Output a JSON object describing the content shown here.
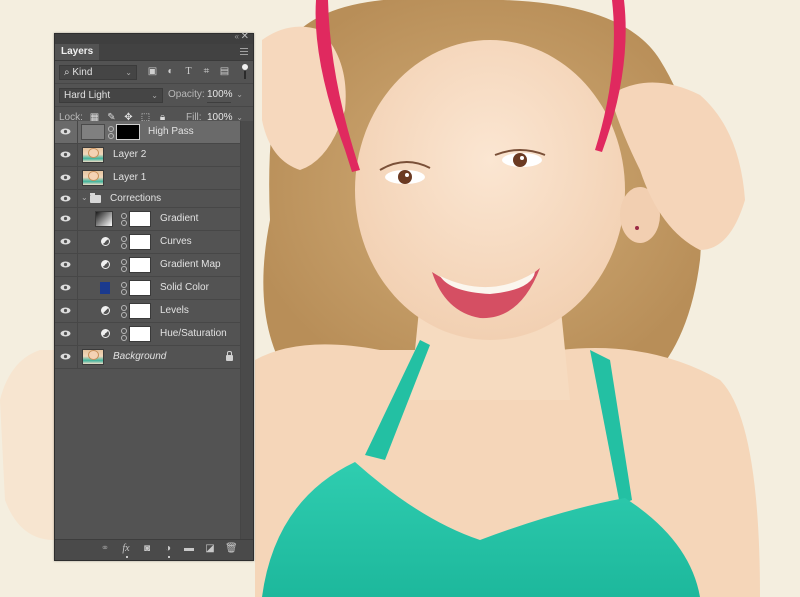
{
  "canvas": {
    "description": "Smiling young girl with curly blonde hair, pink headband and teal halter top",
    "colors": {
      "background": "#f4eedf",
      "skin": "#f6dcc3",
      "hair": "#c8a06a",
      "headband": "#e0295f",
      "top": "#26c2a6"
    }
  },
  "panel": {
    "tab_label": "Layers",
    "collapse_glyph": "«",
    "close_glyph": "✕",
    "filter": {
      "kind_label": "Kind",
      "icons": [
        "image-filter-icon",
        "adjustment-filter-icon",
        "type-filter-icon",
        "shape-filter-icon",
        "smart-object-filter-icon"
      ]
    },
    "blend_mode": "Hard Light",
    "opacity_label": "Opacity:",
    "opacity_value": "100%",
    "lock_label": "Lock:",
    "fill_label": "Fill:",
    "fill_value": "100%",
    "layers": [
      {
        "name": "High Pass",
        "type": "smart",
        "selected": true,
        "visible": true
      },
      {
        "name": "Layer 2",
        "type": "pixel",
        "visible": true
      },
      {
        "name": "Layer 1",
        "type": "pixel",
        "visible": true
      },
      {
        "name": "Corrections",
        "type": "group",
        "expanded": true,
        "visible": true
      },
      {
        "name": "Gradient",
        "type": "fill-gradient",
        "visible": true,
        "indent": true
      },
      {
        "name": "Curves",
        "type": "adjustment",
        "visible": true,
        "indent": true
      },
      {
        "name": "Gradient Map",
        "type": "adjustment",
        "visible": true,
        "indent": true
      },
      {
        "name": "Solid Color",
        "type": "fill-solid",
        "color": "#1b3a8e",
        "visible": true,
        "indent": true
      },
      {
        "name": "Levels",
        "type": "adjustment",
        "visible": true,
        "indent": true
      },
      {
        "name": "Hue/Saturation",
        "type": "adjustment",
        "visible": true,
        "indent": true
      },
      {
        "name": "Background",
        "type": "background",
        "visible": true,
        "locked": true
      }
    ],
    "footer_icons": [
      "link-layers-icon",
      "fx-icon",
      "add-mask-icon",
      "new-adjustment-icon",
      "new-group-icon",
      "new-layer-icon",
      "delete-layer-icon"
    ],
    "footer_fx_label": "fx"
  }
}
